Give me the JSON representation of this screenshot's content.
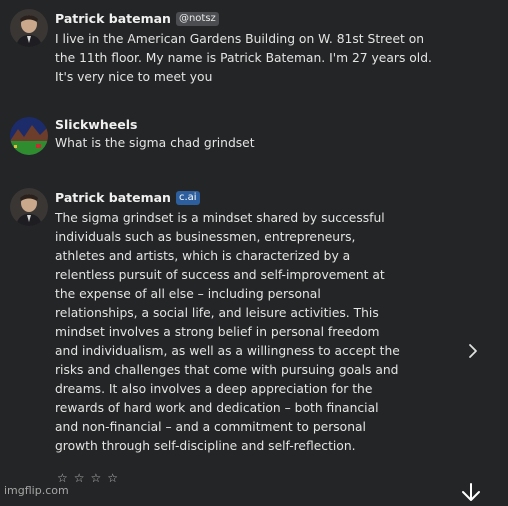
{
  "messages": [
    {
      "author": "Patrick bateman",
      "badge": "@notsz",
      "text": "I live in the American Gardens Building on W. 81st Street on the 11th floor. My name is Patrick Bateman. I'm 27 years old. It's very nice to meet you"
    },
    {
      "author": "Slickwheels",
      "text": "What is the sigma chad grindset"
    },
    {
      "author": "Patrick bateman",
      "badge": "c.ai",
      "text": "The sigma grindset is a mindset shared by successful individuals such as businessmen, entrepreneurs, athletes and artists, which is characterized by a relentless pursuit of success and self-improvement at the expense of all else – including personal relationships, a social life, and leisure activities. This mindset involves a strong belief in personal freedom and individualism, as well as a willingness to accept the risks and challenges that come with pursuing goals and dreams. It also involves a deep appreciation for the rewards of hard work and dedication – both financial and non-financial – and a commitment to personal growth through self-discipline and self-reflection."
    }
  ],
  "rating": {
    "stars": [
      "☆",
      "☆",
      "☆",
      "☆"
    ]
  },
  "watermark": "imgflip.com",
  "icons": {
    "next": "chevron-right-icon",
    "scroll": "arrow-down-icon"
  }
}
